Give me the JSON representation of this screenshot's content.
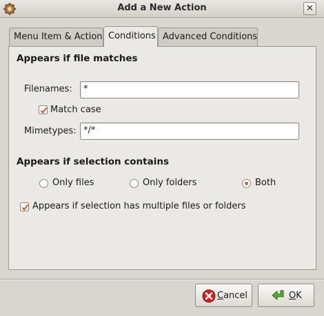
{
  "window": {
    "title": "Add a New Action",
    "close_glyph": "✕"
  },
  "tabs": [
    {
      "label": "Menu Item & Action",
      "active": false
    },
    {
      "label": "Conditions",
      "active": true
    },
    {
      "label": "Advanced Conditions",
      "active": false
    }
  ],
  "file_section": {
    "heading": "Appears if file matches",
    "filenames_label": "Filenames:",
    "filenames_value": "*",
    "match_case_label": "Match case",
    "match_case_checked": true,
    "mimetypes_label": "Mimetypes:",
    "mimetypes_value": "*/*"
  },
  "selection_section": {
    "heading": "Appears if selection contains",
    "options": [
      {
        "label": "Only files",
        "selected": false
      },
      {
        "label": "Only folders",
        "selected": false
      },
      {
        "label": "Both",
        "selected": true
      }
    ],
    "multiple_label": "Appears if selection has multiple files or folders",
    "multiple_checked": true
  },
  "buttons": {
    "cancel": "Cancel",
    "ok": "OK"
  },
  "icons": {
    "app": "app-icon",
    "close": "close-icon",
    "cancel": "cancel-icon",
    "ok": "ok-arrow-icon"
  },
  "colors": {
    "accent": "#c8622a",
    "cancel_red": "#cc2222",
    "ok_green": "#5ca93a"
  }
}
